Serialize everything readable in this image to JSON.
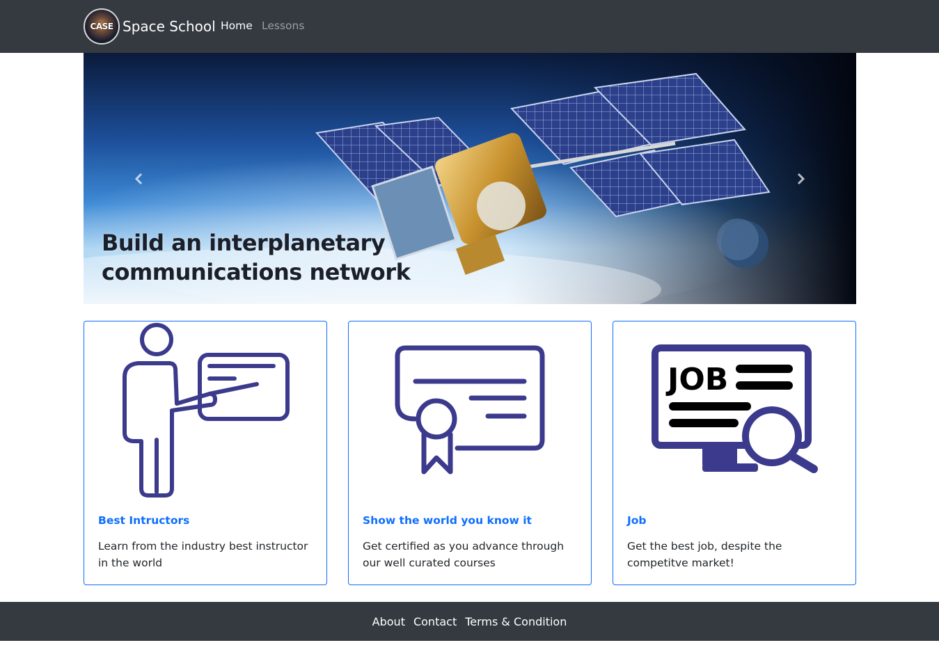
{
  "navbar": {
    "logo_text": "CASE",
    "brand": "Space School",
    "links": [
      {
        "label": "Home",
        "active": true
      },
      {
        "label": "Lessons",
        "active": false
      }
    ]
  },
  "carousel": {
    "caption": "Build an interplanetary communications network",
    "prev_icon": "chevron-left-icon",
    "next_icon": "chevron-right-icon"
  },
  "cards": [
    {
      "title": "Best Intructors",
      "text": "Learn from the industry best instructor in the world",
      "icon": "instructor-icon"
    },
    {
      "title": "Show the world you know it",
      "text": "Get certified as you advance through our well curated courses",
      "icon": "certificate-icon"
    },
    {
      "title": "Job",
      "text": "Get the best job, despite the competitve market!",
      "icon": "job-search-icon",
      "icon_text": "JOB"
    }
  ],
  "footer": {
    "links": [
      "About",
      "Contact",
      "Terms & Condition"
    ]
  },
  "colors": {
    "navbar_bg": "#343a40",
    "accent": "#0d6efd",
    "icon_color": "#3b3a8c"
  }
}
